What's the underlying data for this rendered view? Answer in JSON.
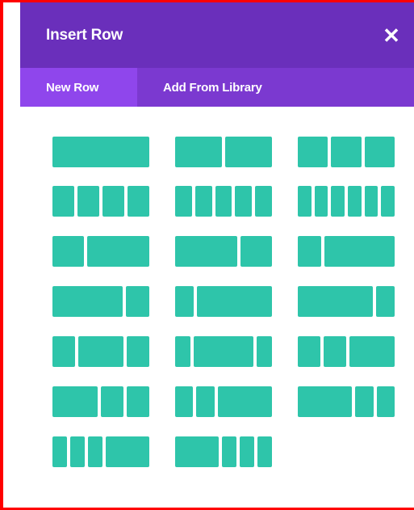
{
  "dialog": {
    "title": "Insert Row",
    "close_icon": "close-icon",
    "close_glyph": "✕"
  },
  "tabs": [
    {
      "label": "New Row",
      "active": true
    },
    {
      "label": "Add From Library",
      "active": false
    }
  ],
  "colors": {
    "header": "#6a2fbb",
    "tabbar": "#7b39d0",
    "active_tab": "#8f46ec",
    "column_block": "#2ec5aa",
    "frame": "#ff0000"
  },
  "layouts": [
    [
      1
    ],
    [
      1,
      1
    ],
    [
      1,
      1,
      1
    ],
    [
      1,
      1,
      1,
      1
    ],
    [
      1,
      1,
      1,
      1,
      1
    ],
    [
      1,
      1,
      1,
      1,
      1,
      1
    ],
    [
      1,
      2
    ],
    [
      2,
      1
    ],
    [
      1,
      3
    ],
    [
      3,
      1
    ],
    [
      1,
      4
    ],
    [
      4,
      1
    ],
    [
      1,
      2,
      1
    ],
    [
      1,
      4,
      1
    ],
    [
      1,
      1,
      2
    ],
    [
      2,
      1,
      1
    ],
    [
      1,
      1,
      3
    ],
    [
      3,
      1,
      1
    ],
    [
      1,
      1,
      1,
      3
    ],
    [
      3,
      1,
      1,
      1
    ]
  ]
}
